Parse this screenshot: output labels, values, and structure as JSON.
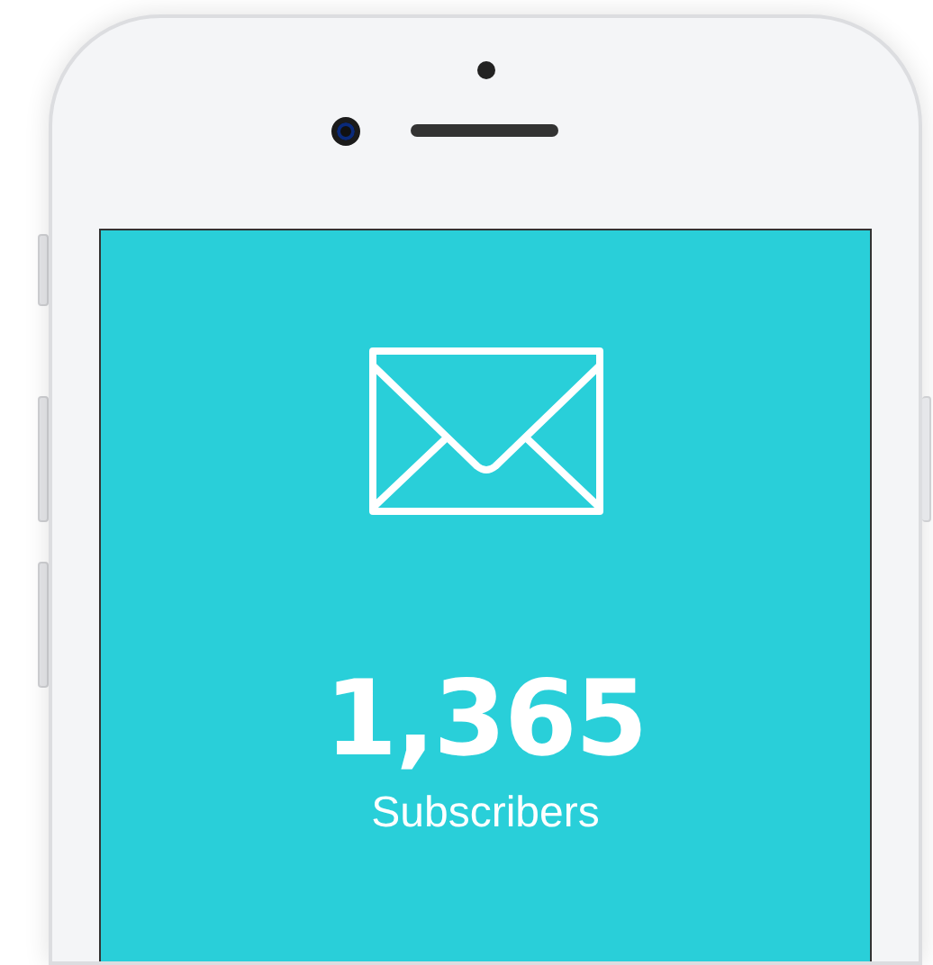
{
  "screen": {
    "count": "1,365",
    "label": "Subscribers"
  }
}
